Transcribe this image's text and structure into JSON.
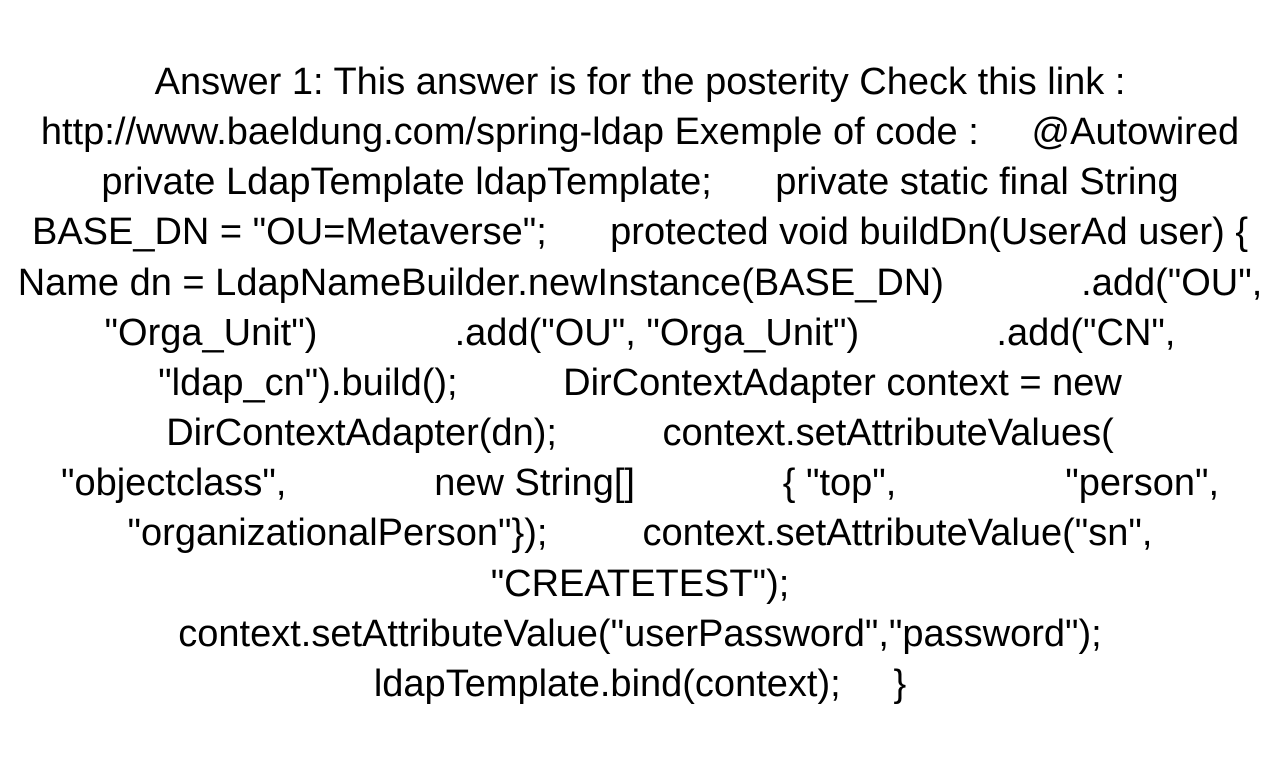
{
  "answer": {
    "text": "Answer 1: This answer is for the posterity Check this link : http://www.baeldung.com/spring-ldap Exemple of code :     @Autowired     private LdapTemplate ldapTemplate;      private static final String BASE_DN = \"OU=Metaverse\";      protected void buildDn(UserAd user) {         Name dn = LdapNameBuilder.newInstance(BASE_DN)             .add(\"OU\", \"Orga_Unit\")             .add(\"OU\", \"Orga_Unit\")             .add(\"CN\", \"ldap_cn\").build();          DirContextAdapter context = new DirContextAdapter(dn);          context.setAttributeValues(             \"objectclass\",              new String[]              { \"top\",                \"person\",                \"organizationalPerson\"});         context.setAttributeValue(\"sn\", \"CREATETEST\");         context.setAttributeValue(\"userPassword\",\"password\");          ldapTemplate.bind(context);     }"
  }
}
